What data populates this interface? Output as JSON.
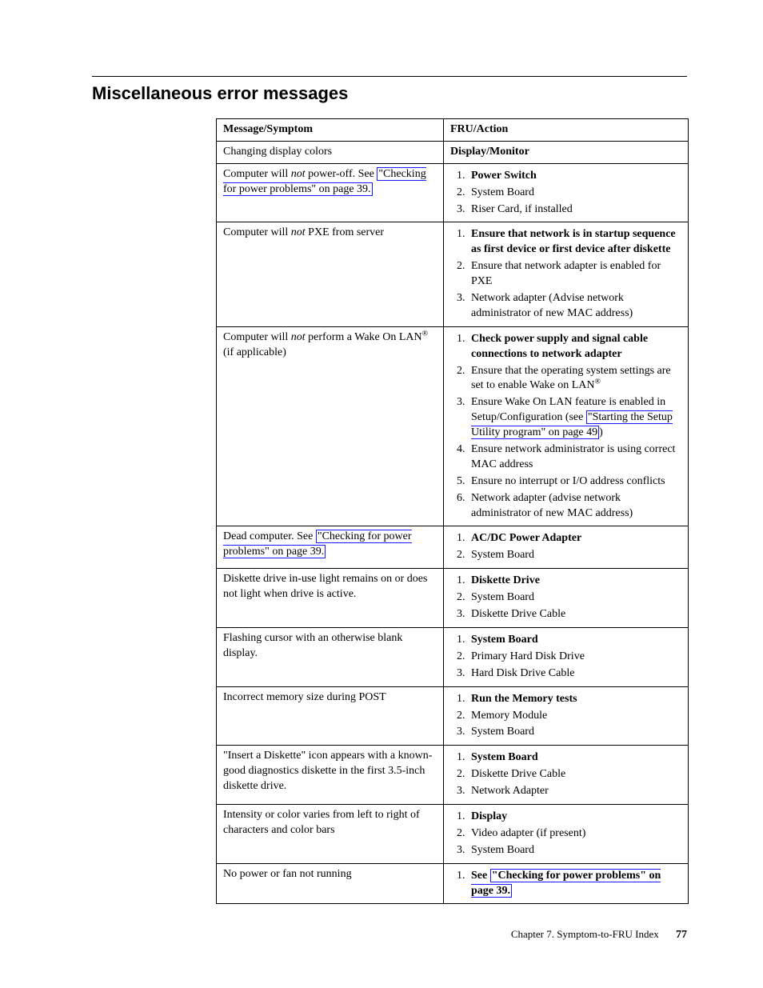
{
  "section_title": "Miscellaneous error messages",
  "headers": {
    "col1": "Message/Symptom",
    "col2": "FRU/Action"
  },
  "rows": [
    {
      "symptom_plain": "Changing display colors",
      "action_plain": "Display/Monitor"
    },
    {
      "symptom_pre": "Computer will ",
      "symptom_ital": "not",
      "symptom_post": " power-off. See ",
      "symptom_link": "\"Checking for power problems\" on page 39.",
      "actions": [
        {
          "bold": "Power Switch"
        },
        {
          "text": "System Board"
        },
        {
          "text": "Riser Card, if installed"
        }
      ]
    },
    {
      "symptom_pre": "Computer will ",
      "symptom_ital": "not",
      "symptom_post": " PXE from server",
      "actions": [
        {
          "bold": "Ensure that network is in startup sequence as first device or first device after diskette"
        },
        {
          "text": "Ensure that network adapter is enabled for PXE"
        },
        {
          "text": "Network adapter (Advise network administrator of new MAC address)"
        }
      ]
    },
    {
      "symptom_pre": "Computer will ",
      "symptom_ital": "not",
      "symptom_post": " perform a Wake On LAN",
      "symptom_sup": "®",
      "symptom_tail": " (if applicable)",
      "actions": [
        {
          "bold": "Check power supply and signal cable connections to network adapter"
        },
        {
          "text_pre": "Ensure that the operating system settings are set to enable Wake on LAN",
          "sup": "®"
        },
        {
          "text_pre": "Ensure Wake On LAN feature is enabled in Setup/Configuration (see ",
          "link": "\"Starting the Setup Utility program\" on page 49",
          "text_post": ")"
        },
        {
          "text": "Ensure network administrator is using correct MAC address"
        },
        {
          "text": "Ensure no interrupt or I/O address conflicts"
        },
        {
          "text": "Network adapter (advise network administrator of new MAC address)"
        }
      ]
    },
    {
      "symptom_pre": "Dead computer. See ",
      "symptom_link": "\"Checking for power problems\" on page 39.",
      "actions": [
        {
          "bold": "AC/DC Power Adapter"
        },
        {
          "text": "System Board"
        }
      ]
    },
    {
      "symptom_plain": "Diskette drive in-use light remains on or does not light when drive is active.",
      "actions": [
        {
          "bold": "Diskette Drive"
        },
        {
          "text": "System Board"
        },
        {
          "text": "Diskette Drive Cable"
        }
      ]
    },
    {
      "symptom_plain": "Flashing cursor with an otherwise blank display.",
      "actions": [
        {
          "bold": "System Board"
        },
        {
          "text": "Primary Hard Disk Drive"
        },
        {
          "text": "Hard Disk Drive Cable"
        }
      ]
    },
    {
      "symptom_plain": "Incorrect memory size during POST",
      "actions": [
        {
          "bold": "Run the Memory tests"
        },
        {
          "text": "Memory Module"
        },
        {
          "text": "System Board"
        }
      ]
    },
    {
      "symptom_plain": "\"Insert a Diskette\" icon appears with a known-good diagnostics diskette in the first 3.5-inch diskette drive.",
      "actions": [
        {
          "bold": "System Board"
        },
        {
          "text": "Diskette Drive Cable"
        },
        {
          "text": "Network Adapter"
        }
      ]
    },
    {
      "symptom_plain": "Intensity or color varies from left to right of characters and color bars",
      "actions": [
        {
          "bold": "Display"
        },
        {
          "text": "Video adapter (if present)"
        },
        {
          "text": "System Board"
        }
      ]
    },
    {
      "symptom_plain": "No power or fan not running",
      "actions": [
        {
          "bold_pre": "See ",
          "bold_link": "\"Checking for power problems\" on page 39."
        }
      ]
    }
  ],
  "footer": {
    "chapter": "Chapter 7. Symptom-to-FRU Index",
    "page": "77"
  }
}
